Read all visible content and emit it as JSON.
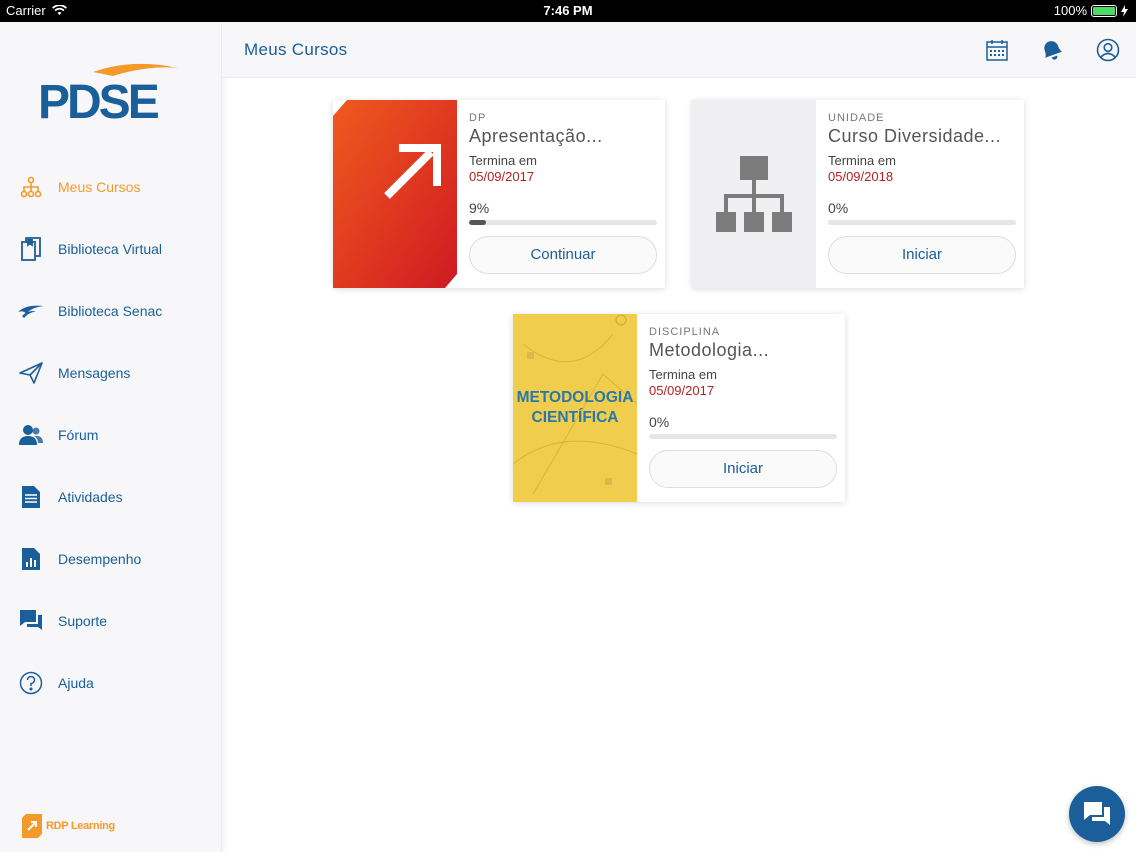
{
  "status_bar": {
    "carrier": "Carrier",
    "time": "7:46 PM",
    "battery": "100%"
  },
  "header": {
    "title": "Meus Cursos",
    "icons": [
      "calendar-icon",
      "notification-bell-icon",
      "profile-icon"
    ]
  },
  "sidebar": {
    "logo_text": "PDSE",
    "items": [
      {
        "label": "Meus Cursos",
        "icon": "hierarchy-icon",
        "active": true
      },
      {
        "label": "Biblioteca Virtual",
        "icon": "book-icon"
      },
      {
        "label": "Biblioteca Senac",
        "icon": "senac-bird-icon"
      },
      {
        "label": "Mensagens",
        "icon": "paper-plane-icon"
      },
      {
        "label": "Fórum",
        "icon": "users-icon"
      },
      {
        "label": "Atividades",
        "icon": "document-icon"
      },
      {
        "label": "Desempenho",
        "icon": "chart-document-icon"
      },
      {
        "label": "Suporte",
        "icon": "chat-bubbles-icon"
      },
      {
        "label": "Ajuda",
        "icon": "help-icon"
      }
    ],
    "footer_brand": "RDP Learning"
  },
  "courses": [
    {
      "kind": "DP",
      "name": "Apresentação...",
      "ends_label": "Termina em",
      "ends_date": "05/09/2017",
      "progress_text": "9%",
      "progress": 0.09,
      "button": "Continuar"
    },
    {
      "kind": "UNIDADE",
      "name": "Curso Diversidade...",
      "ends_label": "Termina em",
      "ends_date": "05/09/2018",
      "progress_text": "0%",
      "progress": 0,
      "button": "Iniciar"
    },
    {
      "kind": "DISCIPLINA",
      "name": "Metodologia...",
      "ends_label": "Termina em",
      "ends_date": "05/09/2017",
      "progress_text": "0%",
      "progress": 0,
      "button": "Iniciar",
      "thumb_text": [
        "METODOLOGIA",
        "CIENTÍFICA"
      ]
    }
  ],
  "colors": {
    "brand_blue": "#1a5e9a",
    "accent_orange": "#f39a2b",
    "date_red": "#b22222"
  }
}
